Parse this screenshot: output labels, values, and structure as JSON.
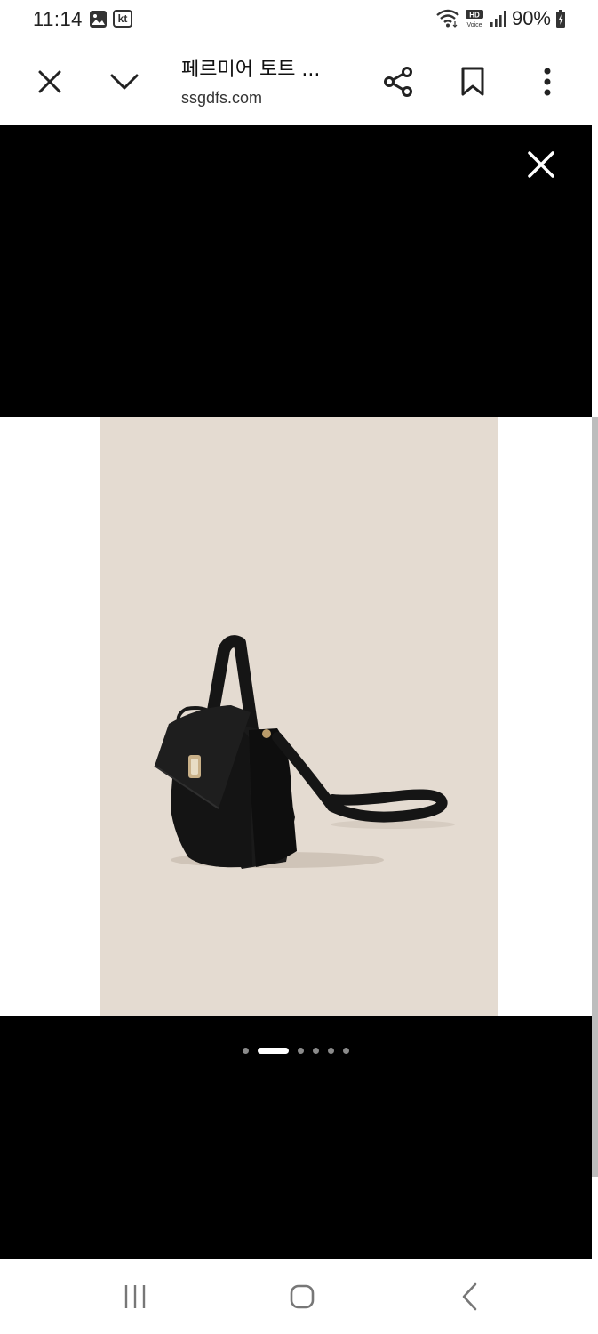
{
  "status_bar": {
    "time": "11:14",
    "carrier_icon_label": "kt",
    "battery_text": "90%",
    "icons": [
      "gallery-icon",
      "kt-carrier-icon",
      "wifi-icon",
      "hd-voice-icon",
      "signal-icon",
      "battery-charging-icon"
    ]
  },
  "toolbar": {
    "title": "페르미어 토트 ...",
    "url": "ssgdfs.com",
    "icons": [
      "close-icon",
      "chevron-down-icon",
      "share-icon",
      "bookmark-icon",
      "more-vert-icon"
    ]
  },
  "viewer": {
    "close_icon": "close-icon",
    "pager": {
      "total": 6,
      "active_index": 1
    }
  },
  "navbar": {
    "icons": [
      "recent-apps-icon",
      "home-icon",
      "back-icon"
    ]
  },
  "colors": {
    "viewer_bg": "#000000",
    "photo_bg": "#e4dbd1",
    "bag": "#151515"
  }
}
